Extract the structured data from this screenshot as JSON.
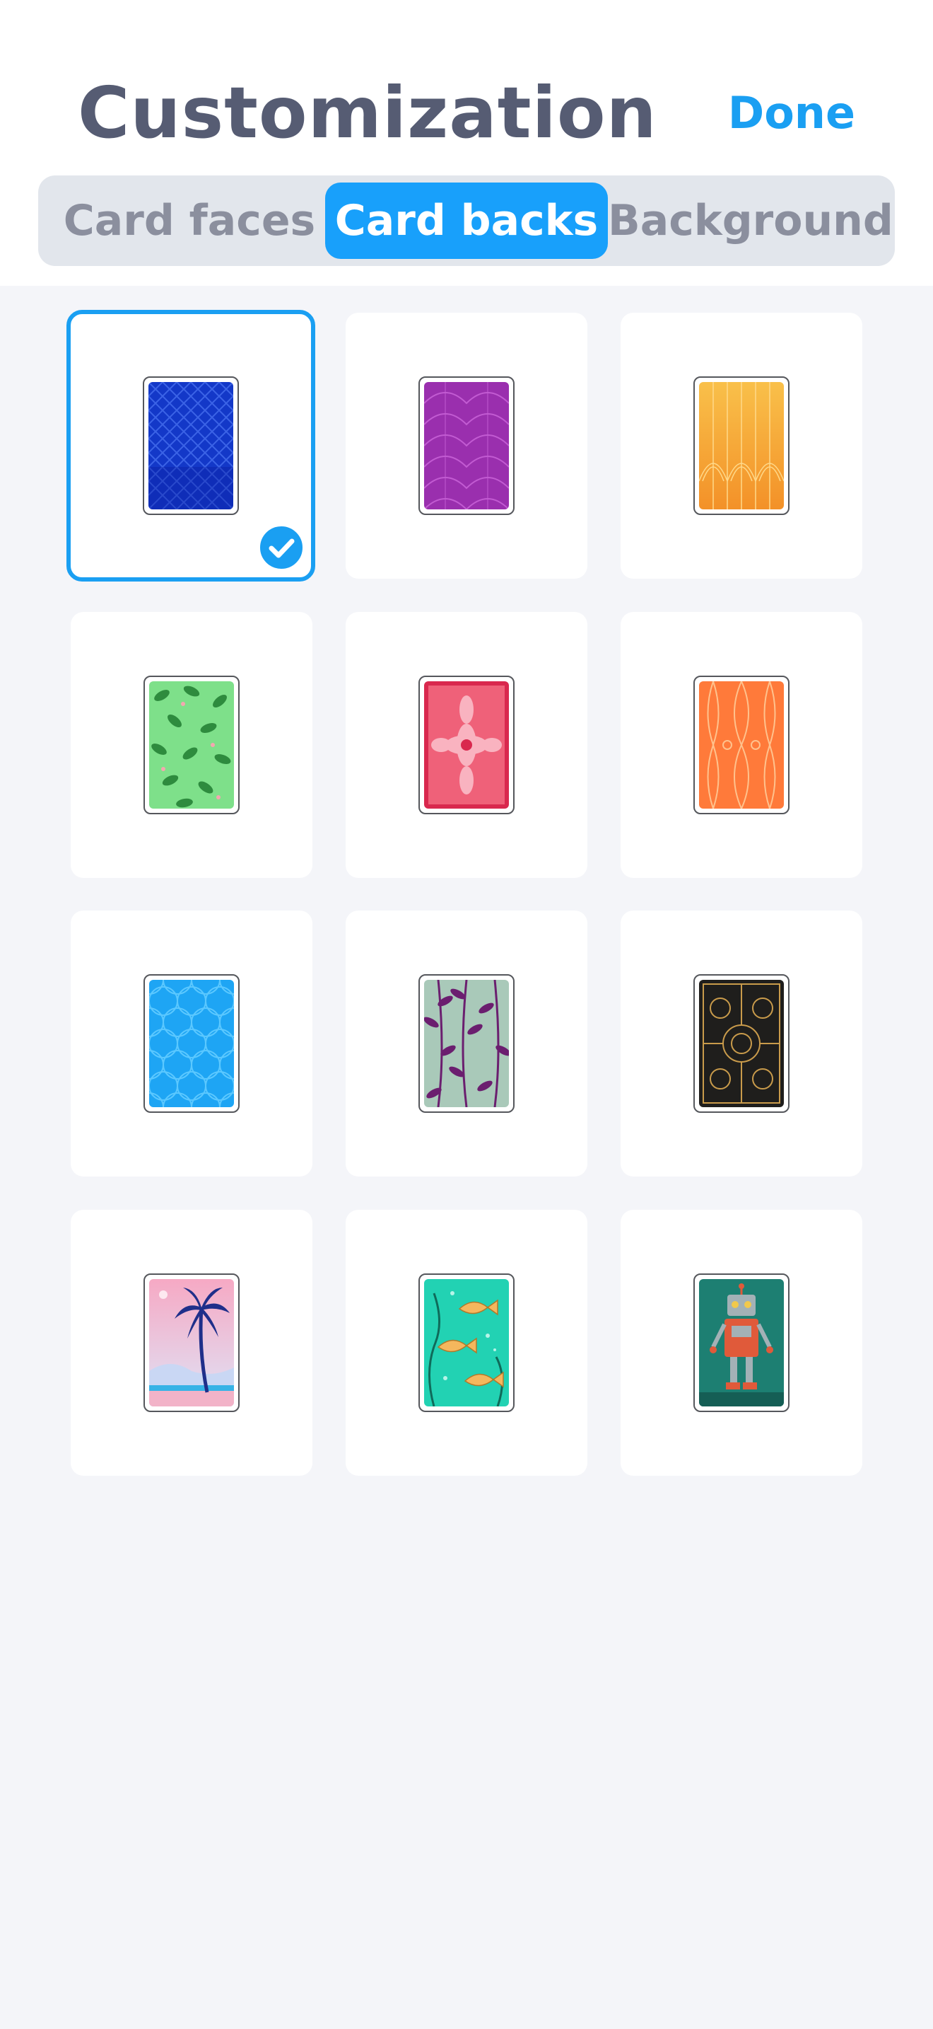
{
  "header": {
    "title": "Customization",
    "done_label": "Done"
  },
  "tabs": [
    {
      "label": "Card faces",
      "active": false
    },
    {
      "label": "Card backs",
      "active": true
    },
    {
      "label": "Background",
      "active": false
    }
  ],
  "card_backs": [
    {
      "name": "blue-diamond",
      "colors": [
        "#1638c9",
        "#0a1f9e"
      ],
      "selected": true
    },
    {
      "name": "purple-scales",
      "colors": [
        "#9b2fad",
        "#74188a"
      ],
      "selected": false
    },
    {
      "name": "orange-deco",
      "colors": [
        "#f7b23c",
        "#f08f2a"
      ],
      "selected": false
    },
    {
      "name": "green-leaves",
      "colors": [
        "#7ee38b",
        "#2f8a3b"
      ],
      "selected": false
    },
    {
      "name": "red-floral",
      "colors": [
        "#e24a63",
        "#f9a7b5"
      ],
      "selected": false
    },
    {
      "name": "orange-feathers",
      "colors": [
        "#ff7a3d",
        "#ffb37a"
      ],
      "selected": false
    },
    {
      "name": "blue-petals",
      "colors": [
        "#1ea7f5",
        "#4cc6ff"
      ],
      "selected": false
    },
    {
      "name": "purple-vines",
      "colors": [
        "#a9c6b8",
        "#6a1f6e"
      ],
      "selected": false
    },
    {
      "name": "gold-swirls",
      "colors": [
        "#1e1e1e",
        "#c99b4b"
      ],
      "selected": false
    },
    {
      "name": "palm-sunset",
      "colors": [
        "#f7b6cc",
        "#213a8f"
      ],
      "selected": false
    },
    {
      "name": "goldfish",
      "colors": [
        "#23d1b5",
        "#f4b55a"
      ],
      "selected": false
    },
    {
      "name": "robot",
      "colors": [
        "#1d7f73",
        "#e05a3a"
      ],
      "selected": false
    }
  ]
}
